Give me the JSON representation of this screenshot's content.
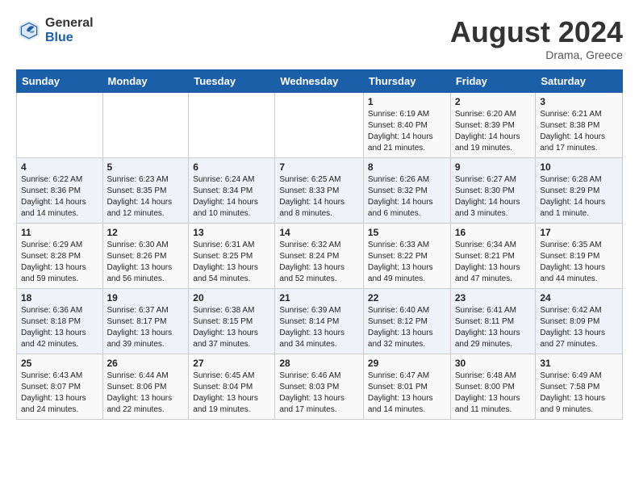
{
  "header": {
    "logo_general": "General",
    "logo_blue": "Blue",
    "month_year": "August 2024",
    "location": "Drama, Greece"
  },
  "days_of_week": [
    "Sunday",
    "Monday",
    "Tuesday",
    "Wednesday",
    "Thursday",
    "Friday",
    "Saturday"
  ],
  "weeks": [
    [
      {
        "day": "",
        "info": ""
      },
      {
        "day": "",
        "info": ""
      },
      {
        "day": "",
        "info": ""
      },
      {
        "day": "",
        "info": ""
      },
      {
        "day": "1",
        "info": "Sunrise: 6:19 AM\nSunset: 8:40 PM\nDaylight: 14 hours and 21 minutes."
      },
      {
        "day": "2",
        "info": "Sunrise: 6:20 AM\nSunset: 8:39 PM\nDaylight: 14 hours and 19 minutes."
      },
      {
        "day": "3",
        "info": "Sunrise: 6:21 AM\nSunset: 8:38 PM\nDaylight: 14 hours and 17 minutes."
      }
    ],
    [
      {
        "day": "4",
        "info": "Sunrise: 6:22 AM\nSunset: 8:36 PM\nDaylight: 14 hours and 14 minutes."
      },
      {
        "day": "5",
        "info": "Sunrise: 6:23 AM\nSunset: 8:35 PM\nDaylight: 14 hours and 12 minutes."
      },
      {
        "day": "6",
        "info": "Sunrise: 6:24 AM\nSunset: 8:34 PM\nDaylight: 14 hours and 10 minutes."
      },
      {
        "day": "7",
        "info": "Sunrise: 6:25 AM\nSunset: 8:33 PM\nDaylight: 14 hours and 8 minutes."
      },
      {
        "day": "8",
        "info": "Sunrise: 6:26 AM\nSunset: 8:32 PM\nDaylight: 14 hours and 6 minutes."
      },
      {
        "day": "9",
        "info": "Sunrise: 6:27 AM\nSunset: 8:30 PM\nDaylight: 14 hours and 3 minutes."
      },
      {
        "day": "10",
        "info": "Sunrise: 6:28 AM\nSunset: 8:29 PM\nDaylight: 14 hours and 1 minute."
      }
    ],
    [
      {
        "day": "11",
        "info": "Sunrise: 6:29 AM\nSunset: 8:28 PM\nDaylight: 13 hours and 59 minutes."
      },
      {
        "day": "12",
        "info": "Sunrise: 6:30 AM\nSunset: 8:26 PM\nDaylight: 13 hours and 56 minutes."
      },
      {
        "day": "13",
        "info": "Sunrise: 6:31 AM\nSunset: 8:25 PM\nDaylight: 13 hours and 54 minutes."
      },
      {
        "day": "14",
        "info": "Sunrise: 6:32 AM\nSunset: 8:24 PM\nDaylight: 13 hours and 52 minutes."
      },
      {
        "day": "15",
        "info": "Sunrise: 6:33 AM\nSunset: 8:22 PM\nDaylight: 13 hours and 49 minutes."
      },
      {
        "day": "16",
        "info": "Sunrise: 6:34 AM\nSunset: 8:21 PM\nDaylight: 13 hours and 47 minutes."
      },
      {
        "day": "17",
        "info": "Sunrise: 6:35 AM\nSunset: 8:19 PM\nDaylight: 13 hours and 44 minutes."
      }
    ],
    [
      {
        "day": "18",
        "info": "Sunrise: 6:36 AM\nSunset: 8:18 PM\nDaylight: 13 hours and 42 minutes."
      },
      {
        "day": "19",
        "info": "Sunrise: 6:37 AM\nSunset: 8:17 PM\nDaylight: 13 hours and 39 minutes."
      },
      {
        "day": "20",
        "info": "Sunrise: 6:38 AM\nSunset: 8:15 PM\nDaylight: 13 hours and 37 minutes."
      },
      {
        "day": "21",
        "info": "Sunrise: 6:39 AM\nSunset: 8:14 PM\nDaylight: 13 hours and 34 minutes."
      },
      {
        "day": "22",
        "info": "Sunrise: 6:40 AM\nSunset: 8:12 PM\nDaylight: 13 hours and 32 minutes."
      },
      {
        "day": "23",
        "info": "Sunrise: 6:41 AM\nSunset: 8:11 PM\nDaylight: 13 hours and 29 minutes."
      },
      {
        "day": "24",
        "info": "Sunrise: 6:42 AM\nSunset: 8:09 PM\nDaylight: 13 hours and 27 minutes."
      }
    ],
    [
      {
        "day": "25",
        "info": "Sunrise: 6:43 AM\nSunset: 8:07 PM\nDaylight: 13 hours and 24 minutes."
      },
      {
        "day": "26",
        "info": "Sunrise: 6:44 AM\nSunset: 8:06 PM\nDaylight: 13 hours and 22 minutes."
      },
      {
        "day": "27",
        "info": "Sunrise: 6:45 AM\nSunset: 8:04 PM\nDaylight: 13 hours and 19 minutes."
      },
      {
        "day": "28",
        "info": "Sunrise: 6:46 AM\nSunset: 8:03 PM\nDaylight: 13 hours and 17 minutes."
      },
      {
        "day": "29",
        "info": "Sunrise: 6:47 AM\nSunset: 8:01 PM\nDaylight: 13 hours and 14 minutes."
      },
      {
        "day": "30",
        "info": "Sunrise: 6:48 AM\nSunset: 8:00 PM\nDaylight: 13 hours and 11 minutes."
      },
      {
        "day": "31",
        "info": "Sunrise: 6:49 AM\nSunset: 7:58 PM\nDaylight: 13 hours and 9 minutes."
      }
    ]
  ]
}
